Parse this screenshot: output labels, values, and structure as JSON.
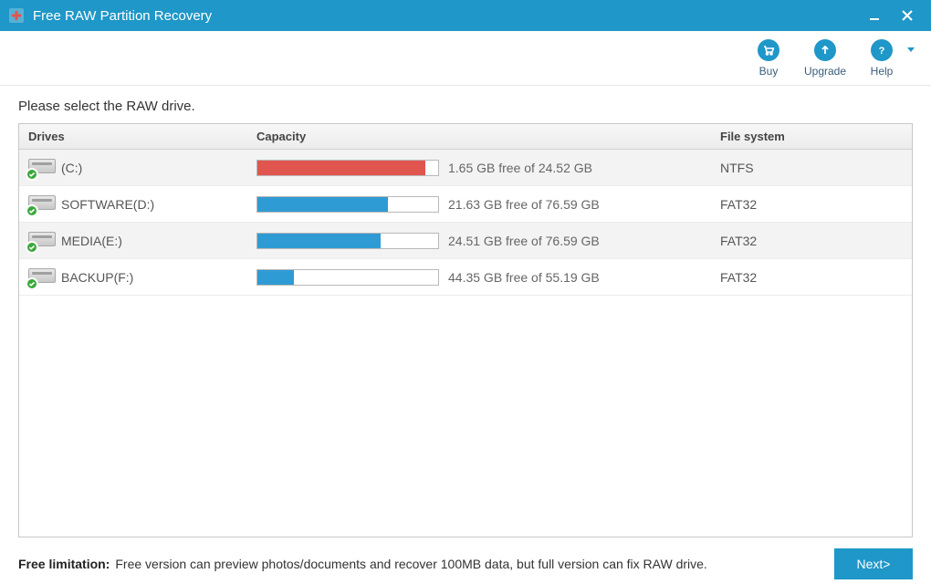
{
  "app_title": "Free RAW Partition Recovery",
  "toolbar": {
    "buy": "Buy",
    "upgrade": "Upgrade",
    "help": "Help"
  },
  "instruction": "Please select the RAW drive.",
  "columns": {
    "drives": "Drives",
    "capacity": "Capacity",
    "fs": "File system"
  },
  "drives": [
    {
      "name": "(C:)",
      "free": 1.65,
      "total": 24.52,
      "used_pct": 93,
      "color": "red",
      "text": "1.65 GB free of 24.52 GB",
      "fs": "NTFS"
    },
    {
      "name": "SOFTWARE(D:)",
      "free": 21.63,
      "total": 76.59,
      "used_pct": 72,
      "color": "blue",
      "text": "21.63 GB free of 76.59 GB",
      "fs": "FAT32"
    },
    {
      "name": "MEDIA(E:)",
      "free": 24.51,
      "total": 76.59,
      "used_pct": 68,
      "color": "blue",
      "text": "24.51 GB free of 76.59 GB",
      "fs": "FAT32"
    },
    {
      "name": "BACKUP(F:)",
      "free": 44.35,
      "total": 55.19,
      "used_pct": 20,
      "color": "blue",
      "text": "44.35 GB free of 55.19 GB",
      "fs": "FAT32"
    }
  ],
  "footer": {
    "label": "Free limitation:",
    "text": "Free version can preview photos/documents and recover 100MB data, but full version can fix RAW drive.",
    "next": "Next>"
  },
  "colors": {
    "accent": "#1f97c8",
    "bar_red": "#e0564f",
    "bar_blue": "#2f9bd4"
  }
}
